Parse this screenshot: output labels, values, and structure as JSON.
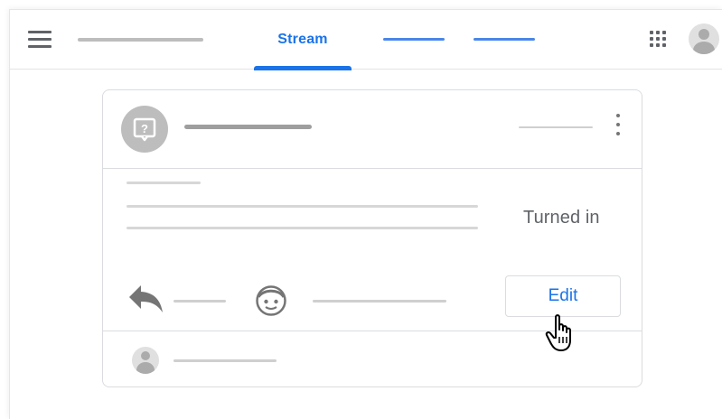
{
  "topbar": {
    "tabs": [
      {
        "label": "Stream",
        "active": true
      }
    ],
    "icons": {
      "menu": "menu-icon",
      "apps": "apps-grid-icon",
      "account": "account-avatar-icon"
    }
  },
  "card": {
    "status": "Turned in",
    "edit_label": "Edit",
    "icons": {
      "question": "question-answer-icon",
      "more": "more-vert-icon",
      "reply": "reply-icon",
      "emoji": "emoji-icon",
      "cursor": "hand-pointer-cursor-icon"
    }
  },
  "colors": {
    "accent": "#1a73e8",
    "placeholder": "#d7d7d7",
    "text_secondary": "#5f6368",
    "border": "#dadce0"
  }
}
